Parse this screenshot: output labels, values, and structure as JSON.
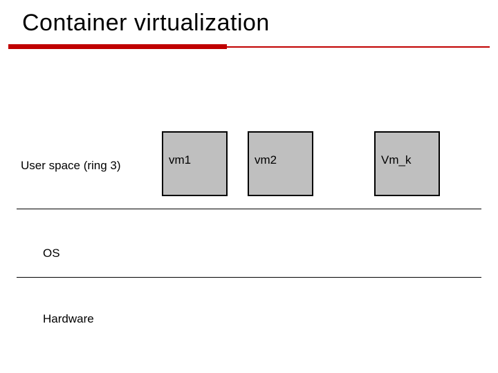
{
  "title": "Container virtualization",
  "layers": {
    "user": "User space (ring 3)",
    "os": "OS",
    "hardware": "Hardware"
  },
  "boxes": {
    "vm1": "vm1",
    "vm2": "vm2",
    "vmk": "Vm_k"
  },
  "colors": {
    "accent": "#c00000",
    "box_fill": "#bfbfbf"
  }
}
